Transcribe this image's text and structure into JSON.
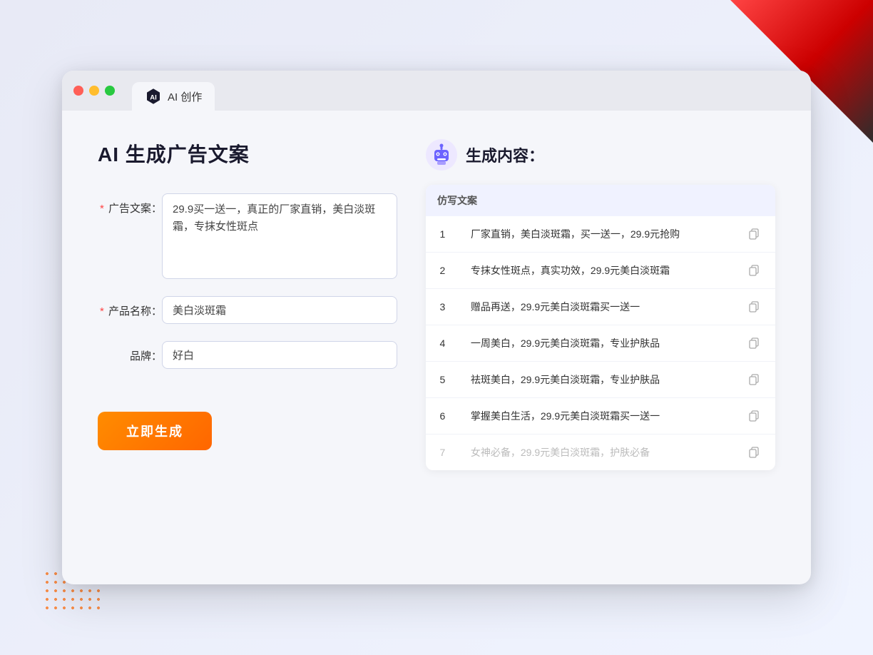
{
  "window": {
    "tab_label": "AI 创作",
    "traffic_lights": [
      "red",
      "yellow",
      "green"
    ]
  },
  "left_panel": {
    "title": "AI 生成广告文案",
    "form": {
      "ad_copy_label": "广告文案：",
      "ad_copy_required": "*",
      "ad_copy_value": "29.9买一送一，真正的厂家直销，美白淡斑霜，专抹女性斑点",
      "product_name_label": "产品名称：",
      "product_name_required": "*",
      "product_name_value": "美白淡斑霜",
      "brand_label": "品牌：",
      "brand_value": "好白"
    },
    "generate_button": "立即生成"
  },
  "right_panel": {
    "title": "生成内容：",
    "table": {
      "header": "仿写文案",
      "rows": [
        {
          "num": "1",
          "text": "厂家直销，美白淡斑霜，买一送一，29.9元抢购",
          "faded": false
        },
        {
          "num": "2",
          "text": "专抹女性斑点，真实功效，29.9元美白淡斑霜",
          "faded": false
        },
        {
          "num": "3",
          "text": "赠品再送，29.9元美白淡斑霜买一送一",
          "faded": false
        },
        {
          "num": "4",
          "text": "一周美白，29.9元美白淡斑霜，专业护肤品",
          "faded": false
        },
        {
          "num": "5",
          "text": "祛斑美白，29.9元美白淡斑霜，专业护肤品",
          "faded": false
        },
        {
          "num": "6",
          "text": "掌握美白生活，29.9元美白淡斑霜买一送一",
          "faded": false
        },
        {
          "num": "7",
          "text": "女神必备，29.9元美白淡斑霜，护肤必备",
          "faded": true
        }
      ]
    }
  },
  "colors": {
    "accent_orange": "#ff6600",
    "accent_blue": "#5b6ee1",
    "required_red": "#ff4444"
  }
}
